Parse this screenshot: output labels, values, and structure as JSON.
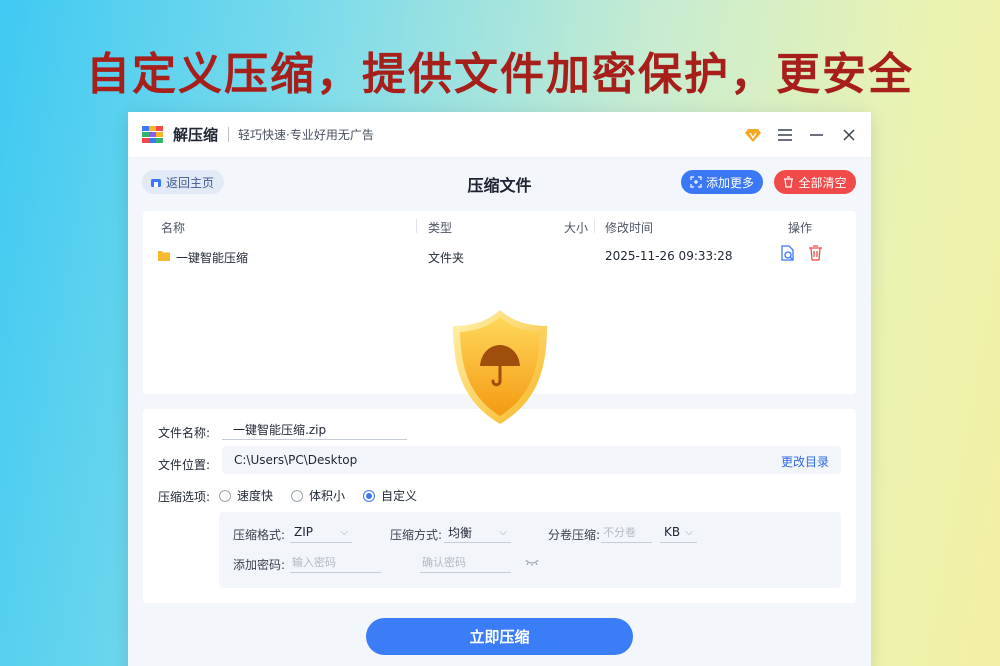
{
  "headline": "自定义压缩，提供文件加密保护，更安全",
  "app": {
    "name": "解压缩",
    "slogan": "轻巧快速·专业好用无广告"
  },
  "toolbar": {
    "back_label": "返回主页",
    "page_title": "压缩文件",
    "add_label": "添加更多",
    "clear_label": "全部清空"
  },
  "table": {
    "headers": {
      "name": "名称",
      "type": "类型",
      "size": "大小",
      "modified": "修改时间",
      "actions": "操作"
    },
    "rows": [
      {
        "name": "一键智能压缩",
        "type": "文件夹",
        "size": "",
        "modified": "2025-11-26 09:33:28"
      }
    ]
  },
  "options": {
    "filename_label": "文件名称:",
    "filename_value": "一键智能压缩.zip",
    "location_label": "文件位置:",
    "location_value": "C:\\Users\\PC\\Desktop",
    "change_dir_label": "更改目录",
    "mode_label": "压缩选项:",
    "modes": [
      "速度快",
      "体积小",
      "自定义"
    ],
    "selected_mode": "自定义",
    "format_label": "压缩格式:",
    "format_value": "ZIP",
    "method_label": "压缩方式:",
    "method_value": "均衡",
    "split_label": "分卷压缩:",
    "split_placeholder": "不分卷",
    "split_unit": "KB",
    "password_label": "添加密码:",
    "password_placeholder": "输入密码",
    "confirm_placeholder": "确认密码"
  },
  "compress_button": "立即压缩",
  "colors": {
    "accent": "#3a78f6",
    "danger": "#f04a4a",
    "headline": "#a61f1a",
    "shield": "#f7b521"
  }
}
